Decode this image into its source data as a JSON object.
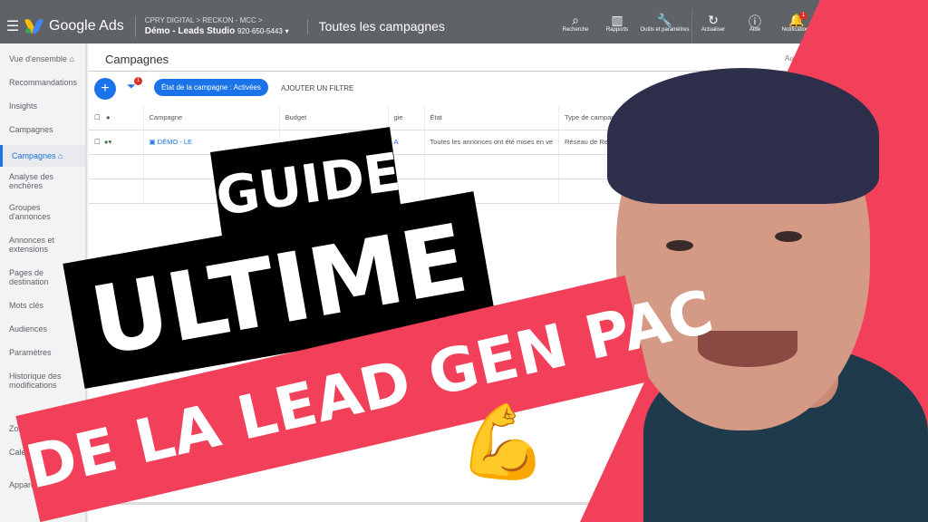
{
  "header": {
    "app_name": "Google Ads",
    "account_path": "CPRY DIGITAL  >  RECKON - MCC  >",
    "account_name": "Démo - Leads Studio",
    "account_id": "920-650-5443",
    "page_title": "Toutes les campagnes",
    "tools": [
      {
        "label": "Recherche",
        "icon": "search-icon"
      },
      {
        "label": "Rapports",
        "icon": "reports-icon"
      },
      {
        "label": "Outils et paramètres",
        "icon": "wrench-icon"
      },
      {
        "label": "Actualiser",
        "icon": "refresh-icon"
      },
      {
        "label": "Aide",
        "icon": "help-icon"
      },
      {
        "label": "Notifications",
        "icon": "bell-icon",
        "badge": "1"
      }
    ]
  },
  "sidebar": {
    "items": [
      {
        "label": "Vue d'ensemble"
      },
      {
        "label": "Recommandations"
      },
      {
        "label": "Insights"
      },
      {
        "label": "Campagnes"
      },
      {
        "label": "Campagnes"
      },
      {
        "label": "Analyse des enchères"
      },
      {
        "label": "Groupes d'annonces"
      },
      {
        "label": "Annonces et extensions"
      },
      {
        "label": "Pages de destination"
      },
      {
        "label": "Mots clés"
      },
      {
        "label": "Audiences"
      },
      {
        "label": "Paramètres"
      },
      {
        "label": "Historique des modifications"
      },
      {
        "label": "Zor"
      },
      {
        "label": "Calen diffus"
      },
      {
        "label": "Appareils"
      }
    ]
  },
  "main": {
    "title": "Campagnes",
    "filter_badge": "1",
    "filter_chip": "État de la campagne : Activées",
    "add_filter": "AJOUTER UN FILTRE",
    "right_hint": "Au",
    "columns": [
      "Campagne",
      "Budget",
      "gie",
      "État",
      "Type de campagne"
    ],
    "row": {
      "campaign": "DÉMO - LE",
      "strategy": "A",
      "status": "Toutes les annonces ont été mises en ve",
      "type": "Réseau de Recherche"
    }
  },
  "overlay": {
    "line1": "GUIDE",
    "line2": "ULTIME",
    "line3": "DE LA LEAD GEN PAC",
    "emoji": "💪"
  },
  "colors": {
    "accent": "#1a73e8",
    "banner_red": "#f2405a",
    "header": "#5f6368"
  }
}
